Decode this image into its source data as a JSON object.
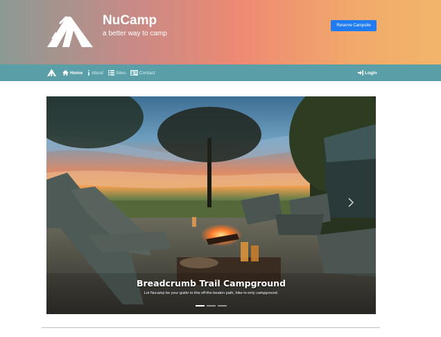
{
  "header": {
    "brand_title": "NuCamp",
    "brand_subtitle": "a better way to camp",
    "reserve_label": "Reserve Campsite",
    "reserve_color": "#1f7bf2"
  },
  "nav": {
    "items": [
      {
        "label": "Home",
        "icon": "home-icon",
        "active": true
      },
      {
        "label": "About",
        "icon": "info-icon",
        "active": false
      },
      {
        "label": "Sites",
        "icon": "list-icon",
        "active": false
      },
      {
        "label": "Contact",
        "icon": "address-card-icon",
        "active": false
      }
    ],
    "login_label": "Login",
    "bar_color": "#5a9fa8"
  },
  "carousel": {
    "caption_title": "Breadcrumb Trail Campground",
    "caption_text": "Let Nucamp be your guide to this off-the-beaten path, hike-in-only campground.",
    "slide_count": 3,
    "active_slide": 1
  }
}
